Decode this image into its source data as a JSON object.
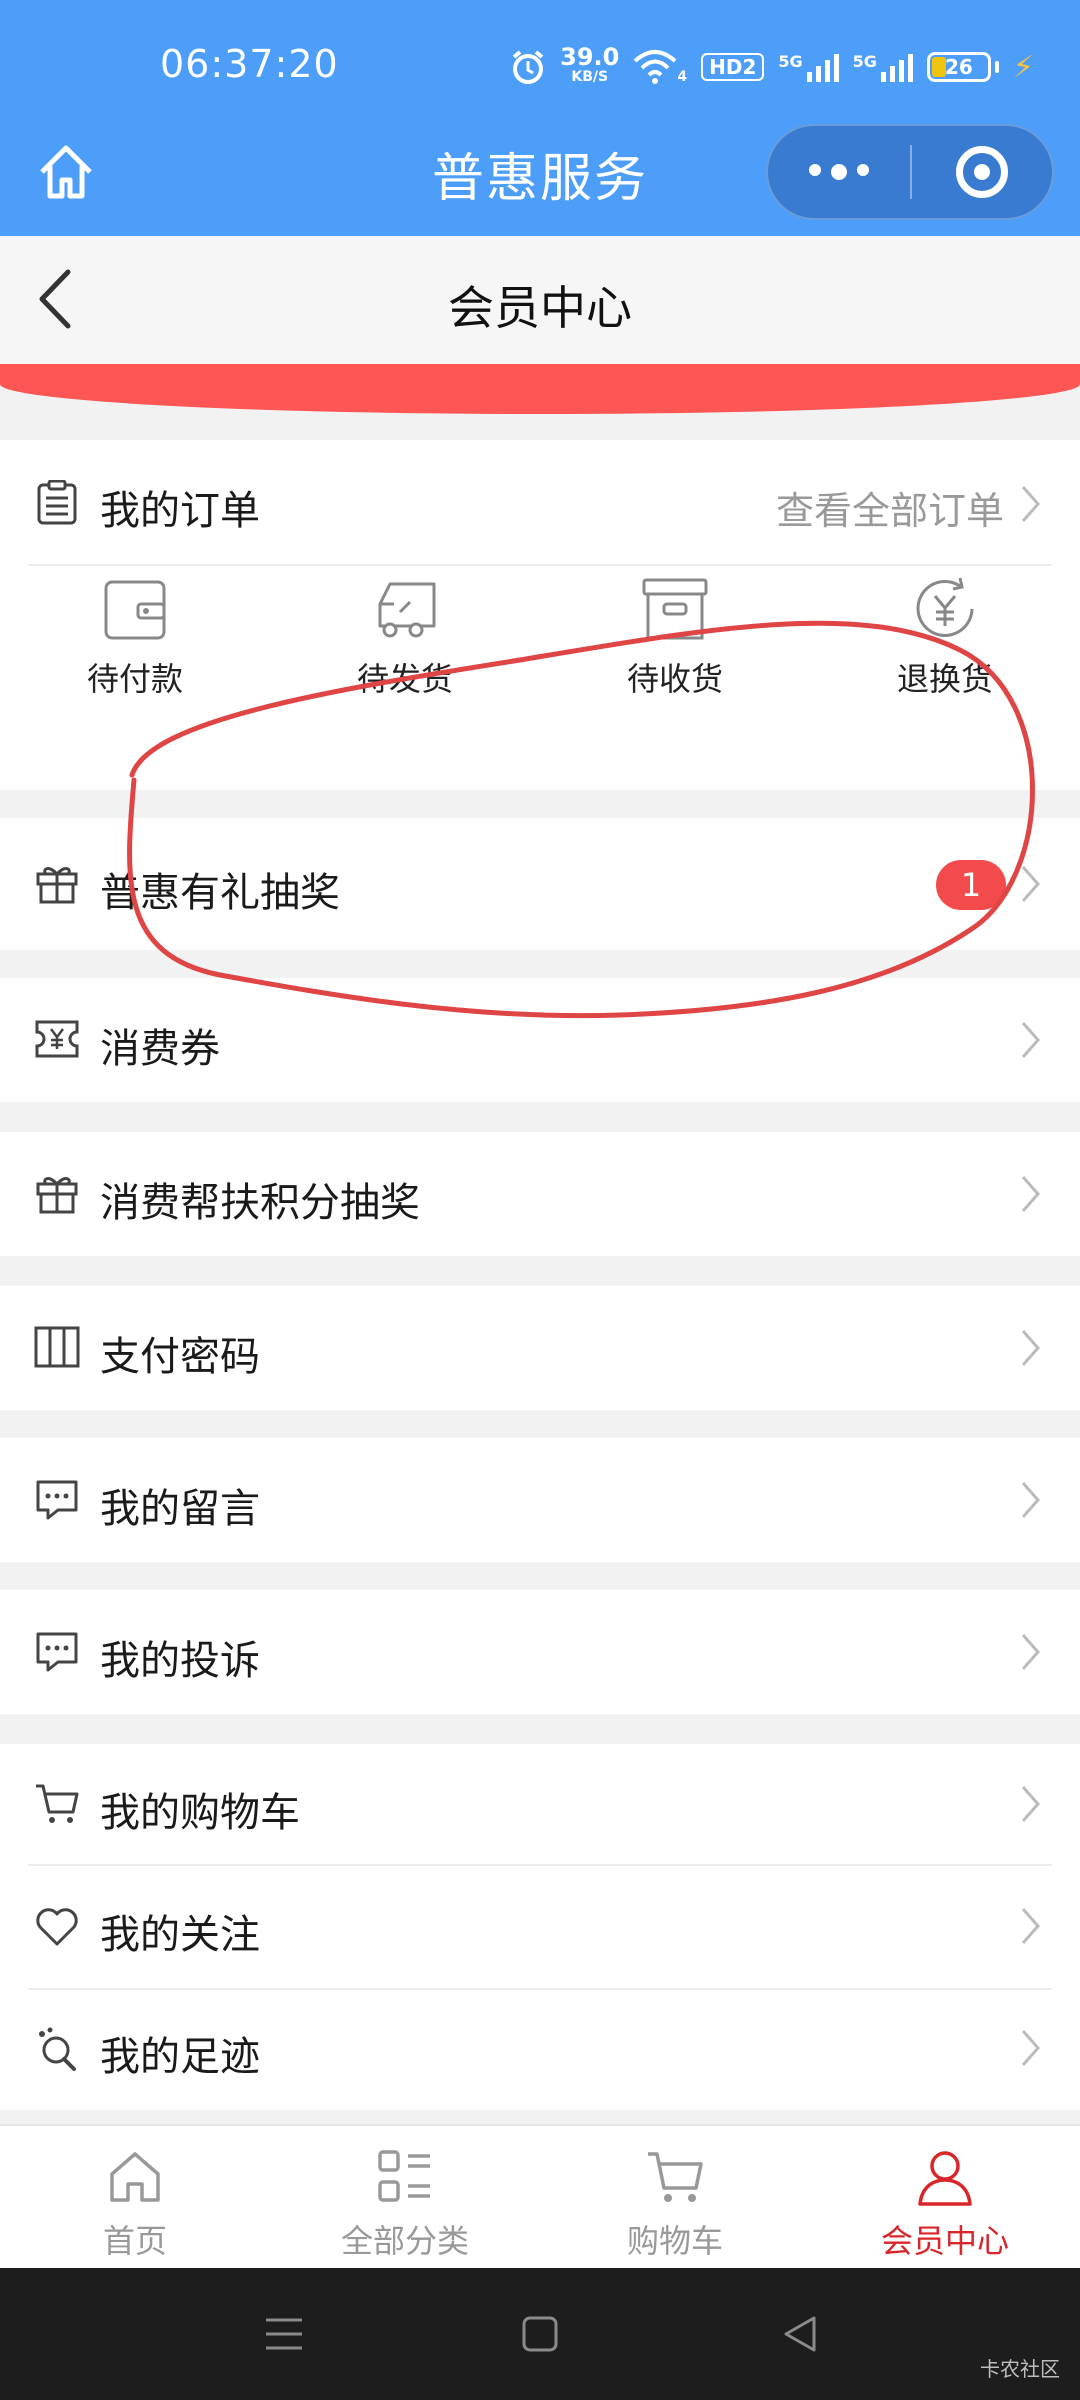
{
  "status_bar": {
    "time": "06:37:20",
    "net_speed_value": "39.0",
    "net_speed_unit": "KB/S",
    "wifi_label": "4",
    "hd_label": "HD2",
    "sig1_label": "5G",
    "sig2_label": "5G",
    "battery": "26"
  },
  "app_header": {
    "title": "普惠服务"
  },
  "nav": {
    "title": "会员中心"
  },
  "orders": {
    "title": "我的订单",
    "view_all": "查看全部订单",
    "statuses": [
      {
        "label": "待付款",
        "icon": "wallet-icon"
      },
      {
        "label": "待发货",
        "icon": "truck-icon"
      },
      {
        "label": "待收货",
        "icon": "box-icon"
      },
      {
        "label": "退换货",
        "icon": "yuan-refund-icon"
      }
    ]
  },
  "menu": {
    "lottery": {
      "label": "普惠有礼抽奖",
      "badge": "1"
    },
    "coupons": {
      "label": "消费券"
    },
    "points_lottery": {
      "label": "消费帮扶积分抽奖"
    },
    "pay_password": {
      "label": "支付密码"
    },
    "messages": {
      "label": "我的留言"
    },
    "complaints": {
      "label": "我的投诉"
    },
    "cart": {
      "label": "我的购物车"
    },
    "follows": {
      "label": "我的关注"
    },
    "footprints": {
      "label": "我的足迹"
    }
  },
  "tabs": [
    {
      "label": "首页",
      "icon": "home-icon",
      "active": false
    },
    {
      "label": "全部分类",
      "icon": "category-icon",
      "active": false
    },
    {
      "label": "购物车",
      "icon": "cart-icon",
      "active": false
    },
    {
      "label": "会员中心",
      "icon": "user-icon",
      "active": true
    }
  ],
  "watermark": "卡农社区",
  "colors": {
    "header_blue": "#4d9ef9",
    "accent_red": "#fe5555",
    "active_tab": "#d8262a",
    "annotation": "#e04545"
  }
}
